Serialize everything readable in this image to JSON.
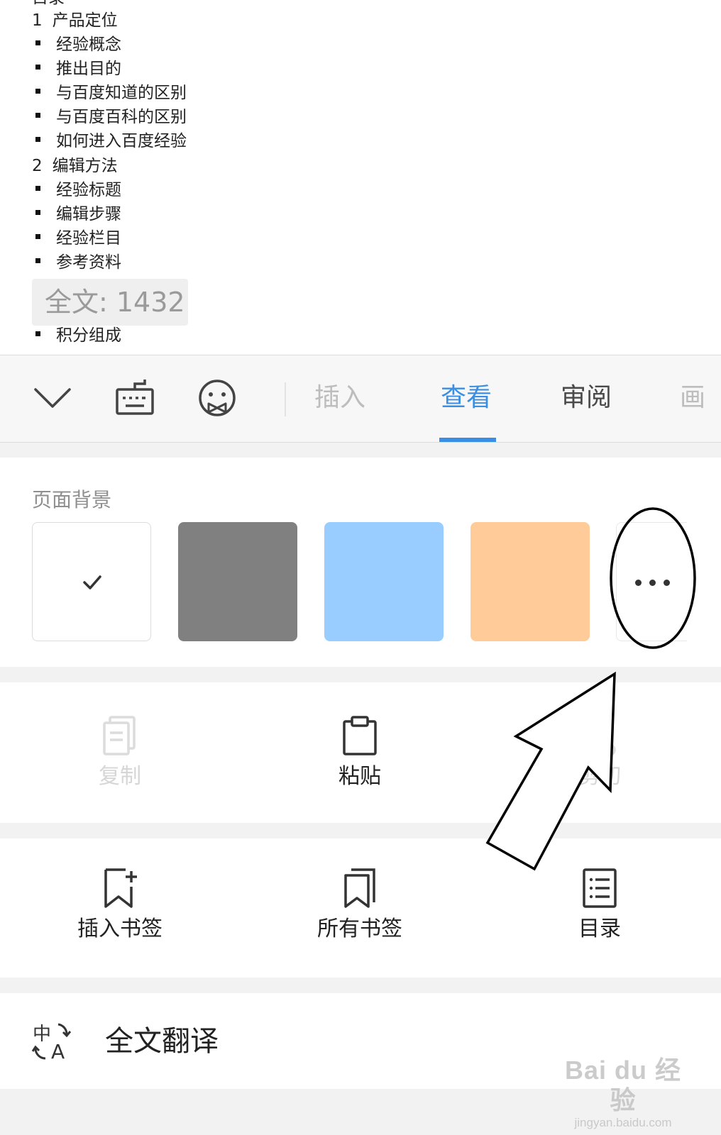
{
  "document": {
    "toc_title": "目录",
    "lines": [
      {
        "type": "head",
        "num": "1",
        "text": "产品定位"
      },
      {
        "type": "item",
        "text": "经验概念"
      },
      {
        "type": "item",
        "text": "推出目的"
      },
      {
        "type": "item",
        "text": "与百度知道的区别"
      },
      {
        "type": "item",
        "text": "与百度百科的区别"
      },
      {
        "type": "item",
        "text": "如何进入百度经验"
      },
      {
        "type": "head",
        "num": "2",
        "text": "编辑方法"
      },
      {
        "type": "item",
        "text": "经验标题"
      },
      {
        "type": "item",
        "text": "编辑步骤"
      },
      {
        "type": "item",
        "text": "经验栏目"
      },
      {
        "type": "item",
        "text": "参考资料"
      },
      {
        "type": "item",
        "text": "积分组成"
      }
    ],
    "word_count": "全文: 1432"
  },
  "toolbar": {
    "icons": [
      "collapse-chevron-icon",
      "keyboard-icon",
      "emoji-icon"
    ],
    "tabs": [
      {
        "label": "插入",
        "state": "dim"
      },
      {
        "label": "查看",
        "state": "active"
      },
      {
        "label": "审阅",
        "state": "normal"
      },
      {
        "label": "画",
        "state": "dim"
      }
    ],
    "accent_color": "#3b8fe2"
  },
  "page_background": {
    "title": "页面背景",
    "swatches": [
      {
        "color": "#ffffff",
        "selected": true
      },
      {
        "color": "#808080",
        "selected": false
      },
      {
        "color": "#99ccff",
        "selected": false
      },
      {
        "color": "#ffcc99",
        "selected": false
      }
    ],
    "more_icon": "more-dots-icon"
  },
  "edit_actions": [
    {
      "label": "复制",
      "icon": "copy-icon",
      "enabled": false
    },
    {
      "label": "粘贴",
      "icon": "paste-icon",
      "enabled": true
    },
    {
      "label": "剪切",
      "icon": "cut-icon",
      "enabled": false
    }
  ],
  "bookmark_actions": [
    {
      "label": "插入书签",
      "icon": "add-bookmark-icon"
    },
    {
      "label": "所有书签",
      "icon": "bookmarks-icon"
    },
    {
      "label": "目录",
      "icon": "toc-icon"
    }
  ],
  "translate": {
    "label": "全文翻译",
    "icon": "translate-icon"
  },
  "watermark": {
    "main": "Bai du 经验",
    "sub": "jingyan.baidu.com"
  }
}
